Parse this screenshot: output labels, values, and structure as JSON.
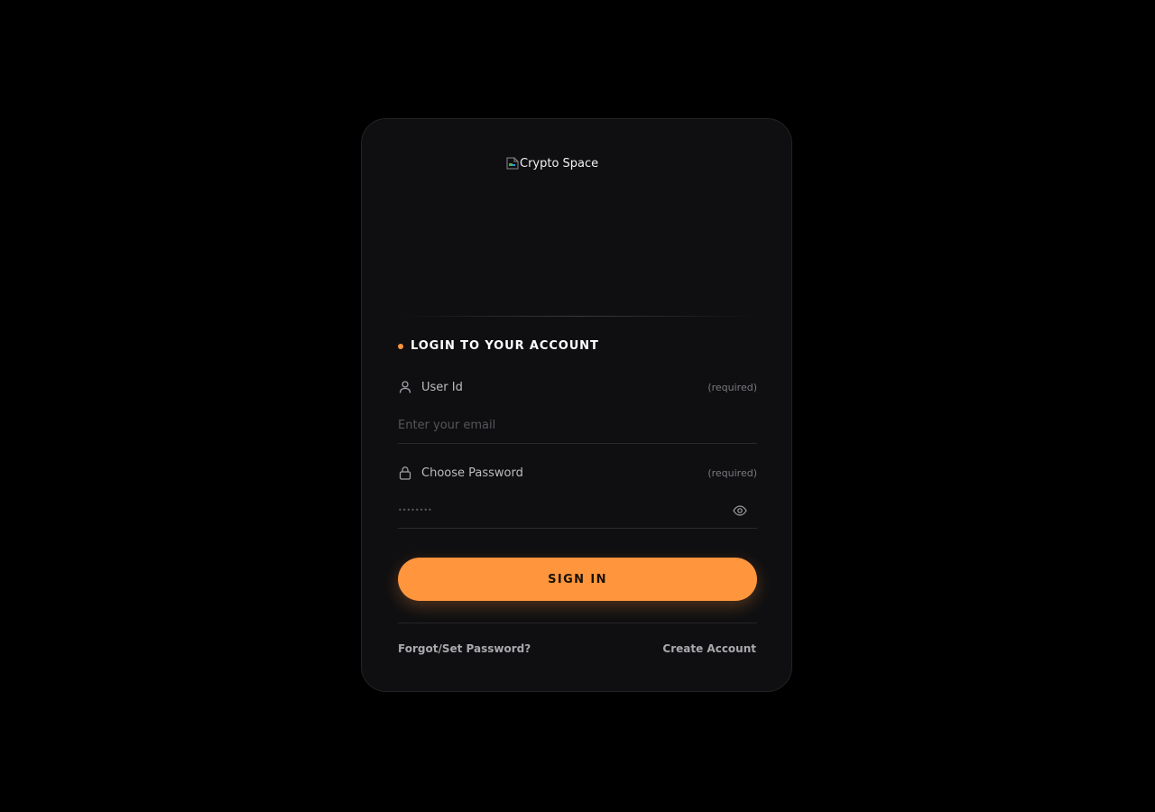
{
  "logo": {
    "alt_text": "Crypto Space",
    "icon": "broken-image-icon"
  },
  "heading": "LOGIN TO YOUR ACCOUNT",
  "fields": {
    "user_id": {
      "label": "User Id",
      "required_text": "(required)",
      "placeholder": "Enter your email",
      "value": "",
      "icon": "user-icon"
    },
    "password": {
      "label": "Choose Password",
      "required_text": "(required)",
      "masked_value": "••••••••",
      "icon": "lock-icon",
      "toggle_icon": "eye-icon"
    }
  },
  "sign_in_label": "SIGN IN",
  "links": {
    "forgot": "Forgot/Set Password?",
    "create": "Create Account"
  },
  "colors": {
    "accent": "#ff953c",
    "card_bg": "#0f0f11",
    "page_bg": "#000000"
  }
}
